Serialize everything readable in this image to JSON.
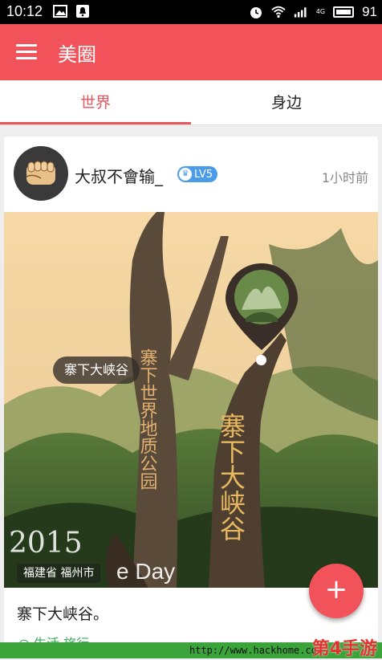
{
  "status_bar": {
    "time": "10:12",
    "battery_percent": "91",
    "left_icons": [
      "image-icon",
      "bell-icon"
    ],
    "right_icons": [
      "alarm-icon",
      "wifi-icon",
      "signal-icon",
      "4g-lte-icon",
      "battery-icon"
    ],
    "network_tag": "4G"
  },
  "app_bar": {
    "title": "美圈",
    "background": "#f2525a"
  },
  "tabs": [
    {
      "label": "世界",
      "active": true
    },
    {
      "label": "身边",
      "active": false
    }
  ],
  "accent_color": "#e5565d",
  "post": {
    "username": "大叔不會输_",
    "level": "LV5",
    "time_ago": "1小时前",
    "location_tag": "寨下大峡谷",
    "overlay_year": "2015",
    "overlay_day_text": "e Day",
    "region": "福建省 福州市",
    "caption": "寨下大峡谷。",
    "partial_link": "◎ 生活 旅行"
  },
  "fab": {
    "label": "+"
  },
  "watermark": {
    "url": "http://www.hackhome.com",
    "logo": "第4手游"
  }
}
